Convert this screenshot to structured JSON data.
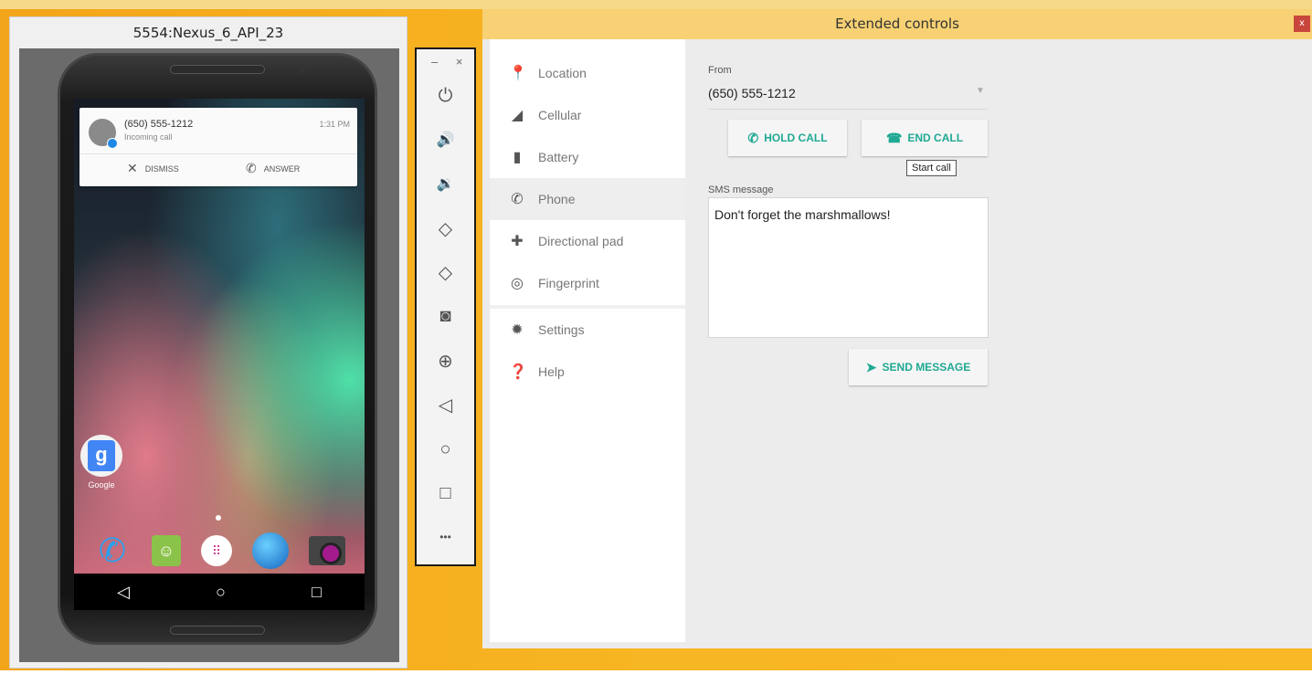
{
  "emulator": {
    "title": "5554:Nexus_6_API_23",
    "notification": {
      "caller": "(650) 555-1212",
      "subtitle": "Incoming call",
      "time": "1:31 PM",
      "dismiss_label": "DISMISS",
      "answer_label": "ANSWER"
    },
    "home": {
      "google_label": "Google",
      "google_glyph": "g"
    }
  },
  "toolbar": {
    "window_controls": "– ×",
    "buttons": [
      {
        "name": "power-icon",
        "glyph": "⏻"
      },
      {
        "name": "volume-up-icon",
        "glyph": "🔊"
      },
      {
        "name": "volume-down-icon",
        "glyph": "🔉"
      },
      {
        "name": "rotate-left-icon",
        "glyph": "◇"
      },
      {
        "name": "rotate-right-icon",
        "glyph": "◇"
      },
      {
        "name": "camera-icon",
        "glyph": "◙"
      },
      {
        "name": "zoom-icon",
        "glyph": "⊕"
      },
      {
        "name": "back-icon",
        "glyph": "◁"
      },
      {
        "name": "home-icon",
        "glyph": "○"
      },
      {
        "name": "overview-icon",
        "glyph": "□"
      },
      {
        "name": "more-icon",
        "glyph": "•••"
      }
    ]
  },
  "extended_controls": {
    "title": "Extended controls",
    "close_label": "x",
    "sidebar": [
      {
        "label": "Location",
        "icon": "location-pin-icon",
        "glyph": "⬤"
      },
      {
        "label": "Cellular",
        "icon": "cellular-signal-icon",
        "glyph": "◢"
      },
      {
        "label": "Battery",
        "icon": "battery-icon",
        "glyph": "▮"
      },
      {
        "label": "Phone",
        "icon": "phone-icon",
        "glyph": "✆"
      },
      {
        "label": "Directional pad",
        "icon": "dpad-icon",
        "glyph": "✚"
      },
      {
        "label": "Fingerprint",
        "icon": "fingerprint-icon",
        "glyph": "◎"
      },
      {
        "label": "Settings",
        "icon": "gear-icon",
        "glyph": "✹"
      },
      {
        "label": "Help",
        "icon": "help-icon",
        "glyph": "❓"
      }
    ],
    "active_item": "Phone",
    "phone": {
      "from_label": "From",
      "from_value": "(650) 555-1212",
      "hold_call_label": "HOLD CALL",
      "end_call_label": "END CALL",
      "tooltip": "Start call",
      "sms_label": "SMS message",
      "sms_value": "Don't forget the marshmallows!",
      "send_label": "SEND MESSAGE"
    },
    "accent_color": "#1fa993"
  }
}
